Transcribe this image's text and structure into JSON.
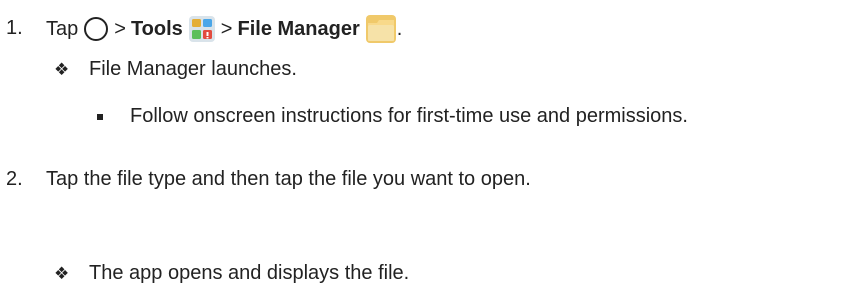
{
  "steps": [
    {
      "number": "1.",
      "parts": {
        "tap": "Tap",
        "sep1": ">",
        "tools": "Tools",
        "sep2": ">",
        "file_manager": "File Manager",
        "period": "."
      },
      "icons": [
        "home-circle-icon",
        "tools-folder-icon",
        "file-manager-folder-icon"
      ]
    },
    {
      "number": "2.",
      "text": "Tap the file type and then tap the file you want to open."
    }
  ],
  "results": [
    {
      "bullet": "❖",
      "text": "File Manager launches."
    },
    {
      "bullet": "❖",
      "text": "The app opens and displays the file."
    }
  ],
  "sub_bullets": [
    {
      "text": "Follow onscreen instructions for first-time use and permissions."
    }
  ]
}
